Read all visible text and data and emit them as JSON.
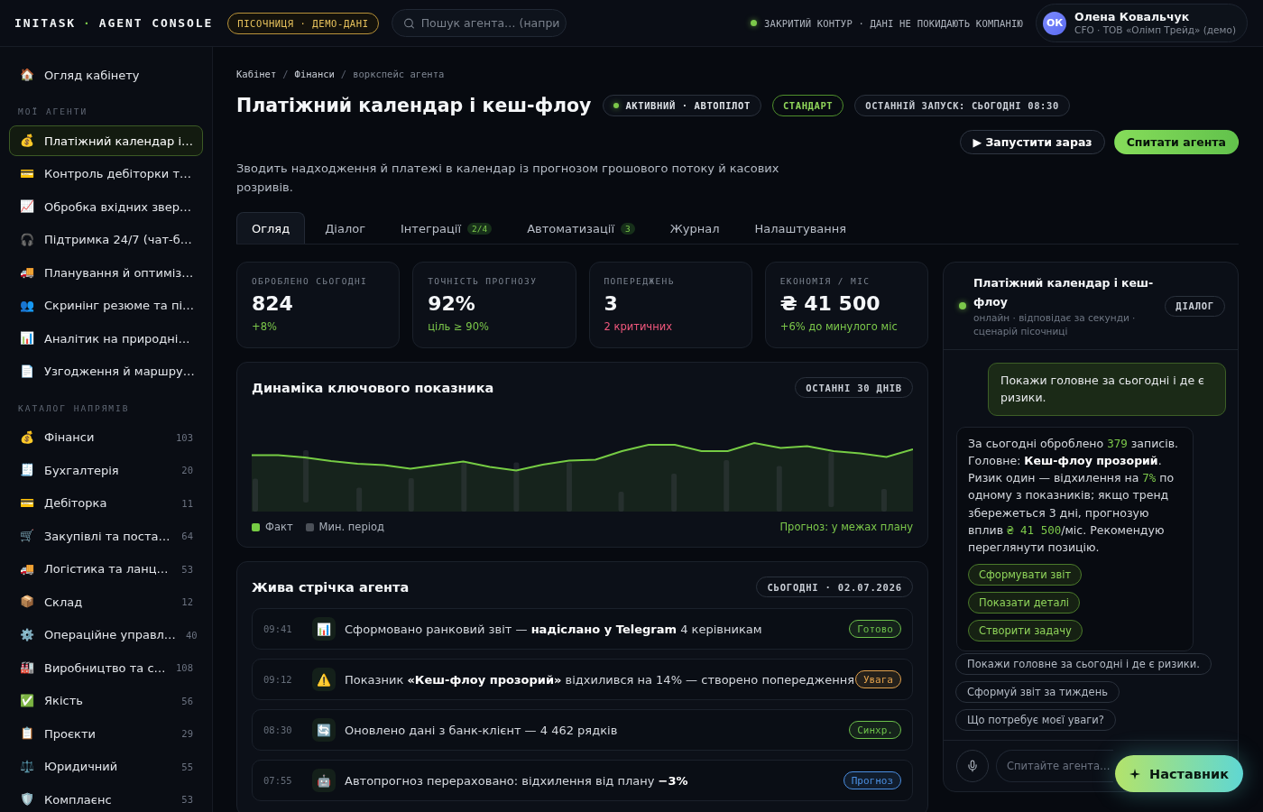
{
  "topbar": {
    "brand": {
      "name": "INITASK",
      "separator": "·",
      "product": "AGENT CONSOLE"
    },
    "sandbox_tag": "ПІСОЧНИЦЯ · ДЕМО-ДАНІ",
    "search": {
      "placeholder": "Пошук агента… (напри"
    },
    "security_note": "ЗАКРИТИЙ КОНТУР · ДАНІ НЕ ПОКИДАЮТЬ КОМПАНІЮ",
    "user": {
      "initials": "ОК",
      "name": "Олена Ковальчук",
      "role": "CFO · ТОВ «Олімп Трейд» (демо)"
    }
  },
  "sidebar": {
    "home": {
      "icon": "🏠",
      "label": "Огляд кабінету",
      "selected": false
    },
    "sections": [
      {
        "title": "МОЇ АГЕНТИ",
        "items": [
          {
            "icon": "💰",
            "label": "Платіжний календар і…",
            "selected": true
          },
          {
            "icon": "💳",
            "label": "Контроль дебіторки т…",
            "selected": false
          },
          {
            "icon": "📈",
            "label": "Обробка вхідних звер…",
            "selected": false
          },
          {
            "icon": "🎧",
            "label": "Підтримка 24/7 (чат-б…",
            "selected": false
          },
          {
            "icon": "🚚",
            "label": "Планування й оптиміз…",
            "selected": false
          },
          {
            "icon": "👥",
            "label": "Скринінг резюме та пі…",
            "selected": false
          },
          {
            "icon": "📊",
            "label": "Аналітик на природні…",
            "selected": false
          },
          {
            "icon": "📄",
            "label": "Узгодження й маршру…",
            "selected": false
          }
        ]
      },
      {
        "title": "КАТАЛОГ НАПРЯМІВ",
        "items": [
          {
            "icon": "💰",
            "label": "Фінанси",
            "count": "103",
            "selected": false
          },
          {
            "icon": "🧾",
            "label": "Бухгалтерія",
            "count": "20",
            "selected": false
          },
          {
            "icon": "💳",
            "label": "Дебіторка",
            "count": "11",
            "selected": false
          },
          {
            "icon": "🛒",
            "label": "Закупівлі та поста…",
            "count": "64",
            "selected": false
          },
          {
            "icon": "🚚",
            "label": "Логістика та ланц…",
            "count": "53",
            "selected": false
          },
          {
            "icon": "📦",
            "label": "Склад",
            "count": "12",
            "selected": false
          },
          {
            "icon": "⚙️",
            "label": "Операційне управл…",
            "count": "40",
            "selected": false
          },
          {
            "icon": "🏭",
            "label": "Виробництво та с…",
            "count": "108",
            "selected": false
          },
          {
            "icon": "✅",
            "label": "Якість",
            "count": "56",
            "selected": false
          },
          {
            "icon": "📋",
            "label": "Проєкти",
            "count": "29",
            "selected": false
          },
          {
            "icon": "⚖️",
            "label": "Юридичний",
            "count": "55",
            "selected": false
          },
          {
            "icon": "🛡️",
            "label": "Комплаєнс",
            "count": "53",
            "selected": false
          }
        ]
      }
    ]
  },
  "breadcrumb": {
    "separator": "/",
    "items": [
      {
        "label": "Кабінет",
        "kind": "link"
      },
      {
        "label": "Фінанси",
        "kind": "link"
      },
      {
        "label": "воркспейс агента",
        "kind": "current"
      }
    ]
  },
  "header": {
    "title": "Платіжний календар і кеш-флоу",
    "badges": [
      {
        "kind": "status",
        "label": "АКТИВНИЙ · АВТОПІЛОТ"
      },
      {
        "kind": "plan",
        "label": "СТАНДАРТ"
      },
      {
        "kind": "info",
        "label": "ОСТАННІЙ ЗАПУСК: СЬОГОДНІ 08:30"
      }
    ],
    "actions": [
      {
        "kind": "secondary",
        "label": "▶ Запустити зараз"
      },
      {
        "kind": "primary",
        "label": "Спитати агента"
      }
    ],
    "description": "Зводить надходження й платежі в календар із прогнозом грошового потоку й касових розривів."
  },
  "tabs": [
    {
      "label": "Огляд",
      "selected": true
    },
    {
      "label": "Діалог",
      "selected": false
    },
    {
      "label": "Інтеграції",
      "count": "2/4",
      "selected": false
    },
    {
      "label": "Автоматизації",
      "count": "3",
      "selected": false
    },
    {
      "label": "Журнал",
      "selected": false
    },
    {
      "label": "Налаштування",
      "selected": false
    }
  ],
  "stats": [
    {
      "label": "ОБРОБЛЕНО СЬОГОДНІ",
      "value": "824",
      "delta": "+8%",
      "color": "#7cc84a"
    },
    {
      "label": "ТОЧНІСТЬ ПРОГНОЗУ",
      "value": "92%",
      "delta": "ціль ≥ 90%",
      "color": "#7cc84a"
    },
    {
      "label": "ПОПЕРЕДЖЕНЬ",
      "value": "3",
      "delta": "2 критичних",
      "color": "#f0577c"
    },
    {
      "label": "ЕКОНОМІЯ / МІС",
      "value": "₴ 41 500",
      "delta": "+6% до минулого міс",
      "color": "#7cc84a"
    }
  ],
  "trend_card": {
    "title": "Динаміка ключового показника",
    "period": "ОСТАННІ 30 ДНІВ",
    "legend": [
      {
        "label": "Факт",
        "color": "#76cc44"
      },
      {
        "label": "Мин. період",
        "color": "#4b5058"
      }
    ],
    "forecast": "Прогноз: у межах плану"
  },
  "feed": {
    "title": "Жива стрічка агента",
    "date": "СЬОГОДНІ · 02.07.2026",
    "events": [
      {
        "time": "09:41",
        "icon": "📊",
        "text": "Сформовано ранковий звіт — **надіслано у Telegram** 4 керівникам",
        "status": "Готово",
        "color": "#6cc04a"
      },
      {
        "time": "09:12",
        "icon": "⚠️",
        "text": "Показник **«Кеш-флоу прозорий»** відхилився на 14% — створено попередження",
        "status": "Увага",
        "color": "#e3a24c"
      },
      {
        "time": "08:30",
        "icon": "🔄",
        "text": "Оновлено дані з банк-клієнт — 4 462 рядків",
        "status": "Синхр.",
        "color": "#6cc04a"
      },
      {
        "time": "07:55",
        "icon": "🤖",
        "text": "Автопрогноз перераховано: відхилення від плану **−3%**",
        "status": "Прогноз",
        "color": "#4b8fe2"
      }
    ]
  },
  "assistant": {
    "title": "Платіжний календар і кеш-флоу",
    "subtitle": "онлайн · відповідає за секунди · сценарій пісочниці",
    "mode": "ДІАЛОГ",
    "messages": [
      {
        "kind": "user",
        "text": "Покажи головне за сьогодні і де є ризики."
      },
      {
        "kind": "agent",
        "segments": [
          {
            "kind": "text",
            "text": "За сьогодні оброблено "
          },
          {
            "kind": "figure",
            "text": "379"
          },
          {
            "kind": "text",
            "text": " записів. Головне: "
          },
          {
            "kind": "strong",
            "text": "Кеш-флоу прозорий"
          },
          {
            "kind": "text",
            "text": ". Ризик один — відхилення на "
          },
          {
            "kind": "figure",
            "text": "7%"
          },
          {
            "kind": "text",
            "text": " по одному з показників; якщо тренд збережеться 3 дні, прогнозую вплив "
          },
          {
            "kind": "figure",
            "text": "₴ 41 500"
          },
          {
            "kind": "text",
            "text": "/міс. Рекомендую переглянути позицію."
          }
        ],
        "actions": [
          "Сформувати звіт",
          "Показати деталі",
          "Створити задачу"
        ]
      }
    ],
    "suggestions": [
      "Покажи головне за сьогодні і де є ризики.",
      "Сформуй звіт за тиждень",
      "Що потребує моєї уваги?"
    ],
    "composer": {
      "placeholder": "Спитайте агента…"
    }
  },
  "coach_button": {
    "label": "Наставник"
  }
}
